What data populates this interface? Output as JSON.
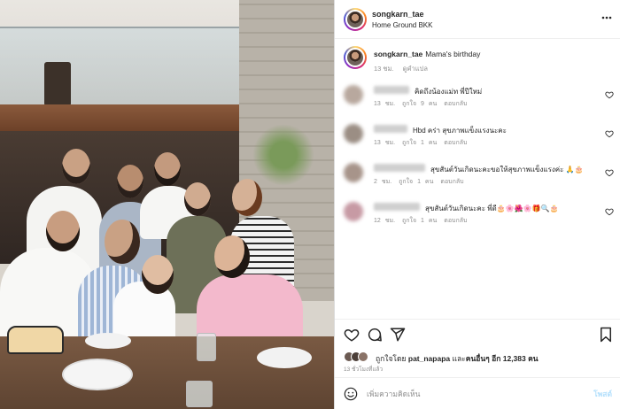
{
  "header": {
    "username": "songkarn_tae",
    "location": "Home Ground BKK"
  },
  "caption": {
    "username": "songkarn_tae",
    "text": "Mama's birthday",
    "time": "13 ชม.",
    "translate": "ดูคำแปล"
  },
  "comments": [
    {
      "text": "คิดถึงน้องแม่ท พี่ปีใหม่",
      "time": "13 ชม.",
      "likes": "ถูกใจ 9 คน",
      "reply": "ตอบกลับ"
    },
    {
      "text": "Hbd คร่า สุขภาพแข็งแรงนะคะ",
      "time": "13 ชม.",
      "likes": "ถูกใจ 1 คน",
      "reply": "ตอบกลับ"
    },
    {
      "text": "สุขสันต์วันเกิดนะคะขอให้สุขภาพแข็งแรงค่ะ 🙏🎂",
      "time": "2 ชม.",
      "likes": "ถูกใจ 1 คน",
      "reply": "ตอบกลับ"
    },
    {
      "text": "สุขสันต์วันเกิดนะคะ พี่ดี🎂🌸🌺🌸🎁🔍🎂",
      "time": "12 ชม.",
      "likes": "ถูกใจ 1 คน",
      "reply": "ตอบกลับ"
    }
  ],
  "likes": {
    "prefix": "ถูกใจโดย",
    "user": "pat_napapa",
    "middle": "และ",
    "others": "คนอื่นๆ อีก 12,383 คน"
  },
  "post_time": "13 ชั่วโมงที่แล้ว",
  "add_comment": {
    "placeholder": "เพิ่มความคิดเห็น",
    "post_label": "โพสต์"
  },
  "icons": {
    "like": "heart-icon",
    "comment": "comment-icon",
    "share": "share-icon",
    "save": "bookmark-icon",
    "emoji": "emoji-icon"
  },
  "colors": {
    "text": "#262626",
    "muted": "#8e8e8e",
    "post_button": "#b2dffc",
    "border": "#dbdbdb"
  }
}
